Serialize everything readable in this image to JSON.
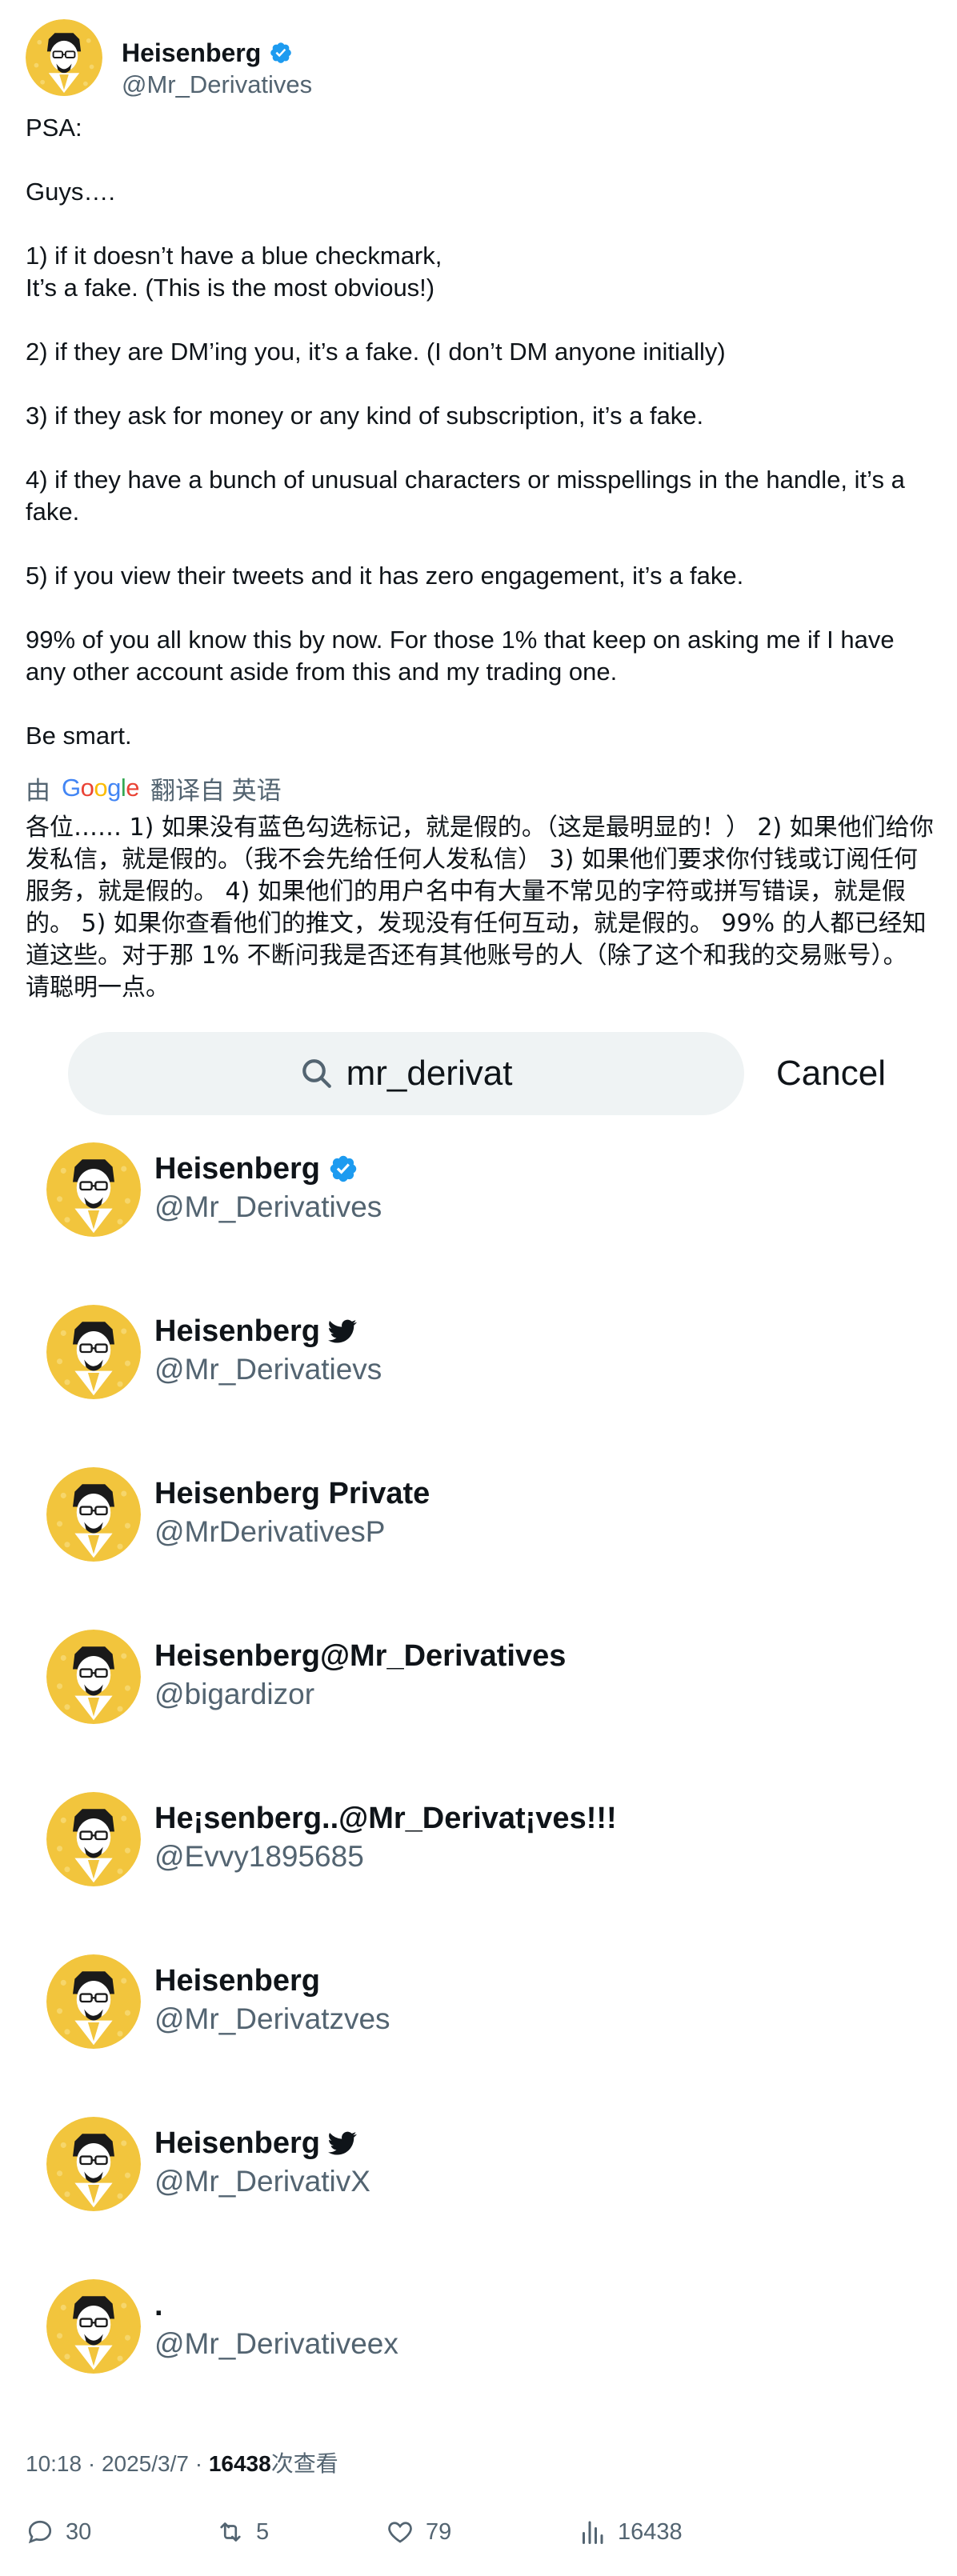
{
  "author": {
    "name": "Heisenberg",
    "handle": "@Mr_Derivatives",
    "verified": true,
    "badge_color": "#1d9bf0"
  },
  "tweet": {
    "lines": [
      "PSA:",
      "",
      "Guys….",
      "",
      "1) if it doesn’t have a blue checkmark,",
      "It’s a fake. (This is the most obvious!)",
      "",
      "2) if they are DM’ing you, it’s a fake. (I don’t DM anyone initially)",
      "",
      "3) if they ask for money or any kind of subscription, it’s a fake.",
      "",
      "4) if they have a bunch of unusual characters or misspellings in the handle, it’s a fake.",
      "",
      "5) if you view their tweets and it has zero engagement, it’s a fake.",
      "",
      "99% of you all know this by now. For those 1% that keep on asking me if I have any other account aside from this and my trading one.",
      "",
      "Be smart."
    ]
  },
  "translation": {
    "by": "由",
    "provider": "Google",
    "label": "翻译自 英语",
    "text": "各位…… 1) 如果没有蓝色勾选标记，就是假的。（这是最明显的！） 2) 如果他们给你发私信，就是假的。（我不会先给任何人发私信） 3) 如果他们要求你付钱或订阅任何服务，就是假的。 4) 如果他们的用户名中有大量不常见的字符或拼写错误，就是假的。 5) 如果你查看他们的推文，发现没有任何互动，就是假的。 99% 的人都已经知道这些。对于那 1% 不断问我是否还有其他账号的人（除了这个和我的交易账号）。 请聪明一点。"
  },
  "search": {
    "query": "mr_derivat",
    "cancel_label": "Cancel"
  },
  "results": [
    {
      "name": "Heisenberg",
      "handle": "@Mr_Derivatives",
      "badge": "verified"
    },
    {
      "name": "Heisenberg",
      "handle": "@Mr_Derivatievs",
      "badge": "bird"
    },
    {
      "name": "Heisenberg Private",
      "handle": "@MrDerivativesP",
      "badge": ""
    },
    {
      "name": "Heisenberg@Mr_Derivatives",
      "handle": "@bigardizor",
      "badge": ""
    },
    {
      "name": "He¡senberg..@Mr_Derivat¡ves!!!",
      "handle": "@Evvy1895685",
      "badge": ""
    },
    {
      "name": "Heisenberg",
      "handle": "@Mr_Derivatzves",
      "badge": ""
    },
    {
      "name": "Heisenberg",
      "handle": "@Mr_DerivativX",
      "badge": "bird"
    },
    {
      "name": ".",
      "handle": "@Mr_Derivativeex",
      "badge": ""
    }
  ],
  "meta": {
    "time": "10:18 · 2025/3/7 · ",
    "views": "16438",
    "views_suffix": "次查看"
  },
  "actions": {
    "replies": "30",
    "retweets": "5",
    "likes": "79",
    "views": "16438"
  },
  "colors": {
    "avatar_yellow": "#f2c53d",
    "verified_blue": "#1d9bf0",
    "secondary_text": "#536471"
  },
  "icons": [
    "verified-badge-icon",
    "search-icon",
    "twitter-bird-icon",
    "reply-icon",
    "retweet-icon",
    "like-icon",
    "views-icon"
  ]
}
